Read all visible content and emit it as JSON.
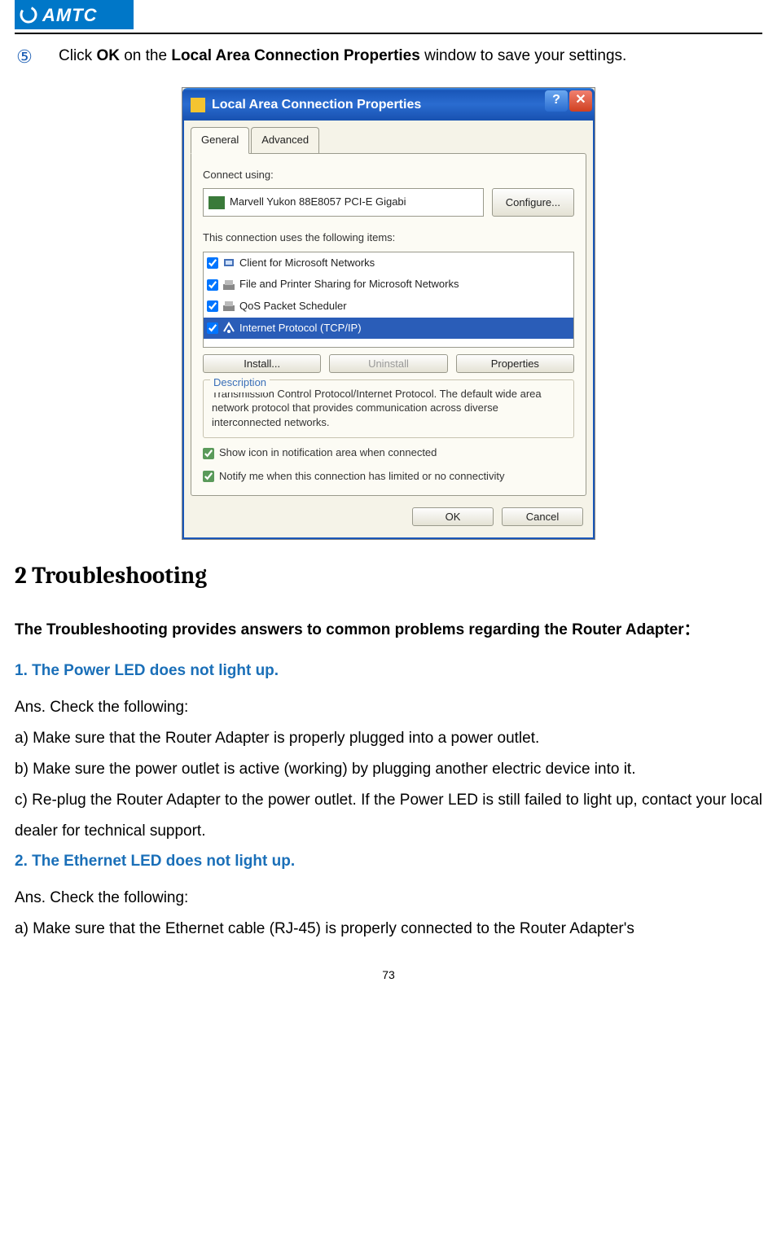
{
  "header": {
    "brand": "AMTC"
  },
  "instruction": {
    "num": "⑤",
    "pre": "Click ",
    "bold1": "OK",
    "mid": " on the ",
    "bold2": "Local Area Connection Properties",
    "post": " window to save your settings."
  },
  "dialog": {
    "title": "Local Area Connection Properties",
    "help_glyph": "?",
    "close_glyph": "✕",
    "tabs": {
      "general": "General",
      "advanced": "Advanced"
    },
    "connect_using_label": "Connect using:",
    "adapter": "Marvell Yukon 88E8057 PCI-E Gigabi",
    "configure_btn": "Configure...",
    "items_label": "This connection uses the following items:",
    "items": [
      {
        "label": "Client for Microsoft Networks",
        "selected": false
      },
      {
        "label": "File and Printer Sharing for Microsoft Networks",
        "selected": false
      },
      {
        "label": "QoS Packet Scheduler",
        "selected": false
      },
      {
        "label": "Internet Protocol (TCP/IP)",
        "selected": true
      }
    ],
    "install_btn": "Install...",
    "uninstall_btn": "Uninstall",
    "properties_btn": "Properties",
    "desc_legend": "Description",
    "desc_text": "Transmission Control Protocol/Internet Protocol. The default wide area network protocol that provides communication across diverse interconnected networks.",
    "chk_showicon": "Show icon in notification area when connected",
    "chk_notify": "Notify me when this connection has limited or no connectivity",
    "ok_btn": "OK",
    "cancel_btn": "Cancel"
  },
  "section": {
    "title": "2 Troubleshooting"
  },
  "intro": "The Troubleshooting provides answers to common problems regarding the Router Adapter：",
  "q1": {
    "title": "1. The Power LED does not light up.",
    "ans_label": "Ans. Check the following:",
    "a": "a) Make sure that the Router Adapter is properly plugged into a power outlet.",
    "b": "b) Make sure the power outlet is active (working) by plugging another electric device into it.",
    "c": "c) Re-plug the Router Adapter to the power outlet. If the Power LED is still failed to light up, contact your local dealer for technical support."
  },
  "q2": {
    "title": "2. The Ethernet LED does not light up.",
    "ans_label": "Ans. Check the following:",
    "a": "a) Make sure that the Ethernet cable (RJ-45) is properly connected to the Router Adapter's"
  },
  "page_num": "73"
}
